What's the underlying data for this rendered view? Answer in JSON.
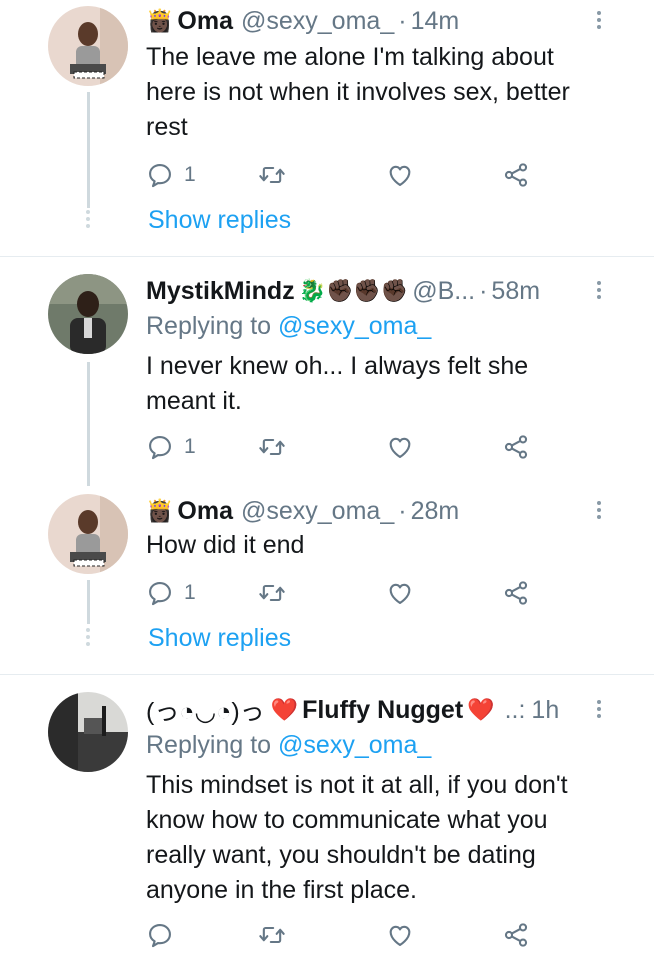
{
  "tweets": [
    {
      "emoji": "👸🏿",
      "name": "Oma",
      "handle": "@sexy_oma_",
      "sep": "·",
      "time": "14m",
      "text": "The leave me alone I'm talking about here is not when it involves sex, better rest",
      "replies": "1",
      "show_replies": "Show replies"
    },
    {
      "name": "MystikMindz",
      "emojis": "🐉✊🏿✊🏿✊🏿",
      "handle": "@B...",
      "sep": "·",
      "time": "58m",
      "replying_prefix": "Replying to",
      "replying_to": "@sexy_oma_",
      "text": "I never knew oh... I always felt she meant it.",
      "replies": "1"
    },
    {
      "emoji": "👸🏿",
      "name": "Oma",
      "handle": "@sexy_oma_",
      "sep": "·",
      "time": "28m",
      "text": "How did it end",
      "replies": "1",
      "show_replies": "Show replies"
    },
    {
      "name_prefix": "(っ◔◡◔)っ",
      "heart_left": "❤️",
      "name": "Fluffy Nugget",
      "heart_right": "❤️",
      "ellipsis": "..:",
      "time": "1h",
      "replying_prefix": "Replying to",
      "replying_to": "@sexy_oma_",
      "text": "This mindset is not it at all, if you don't know how to communicate what you really want, you shouldn't be dating anyone in the first place.",
      "replies": ""
    }
  ],
  "icons": {
    "reply": "reply-icon",
    "retweet": "retweet-icon",
    "like": "like-icon",
    "share": "share-icon",
    "more": "more-options-icon"
  },
  "colors": {
    "accent": "#1da1f2",
    "muted": "#657786",
    "text": "#14171a",
    "line": "#cfd9de"
  }
}
